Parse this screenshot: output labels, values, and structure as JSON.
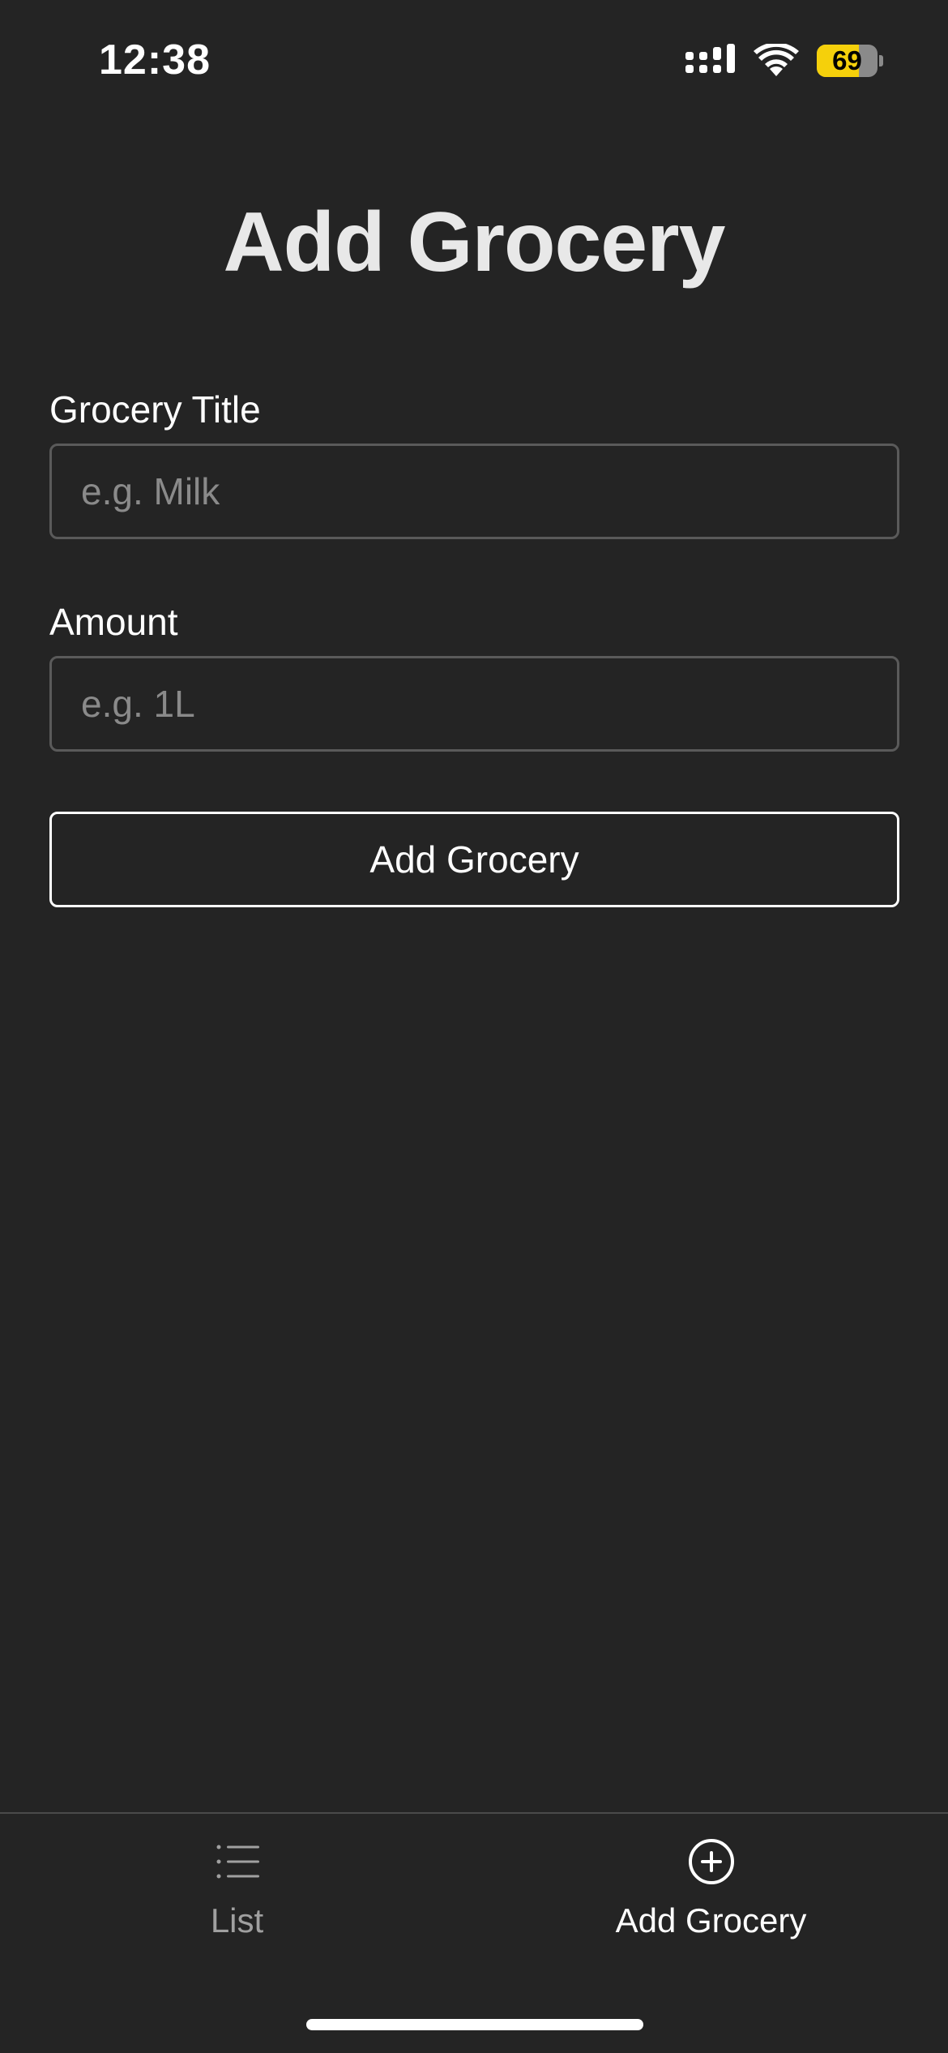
{
  "status_bar": {
    "time": "12:38",
    "battery_level": "69",
    "battery_fraction": 0.69,
    "battery_color": "#f5d00b",
    "icons": [
      "signal-icon",
      "wifi-icon",
      "battery-icon"
    ]
  },
  "page": {
    "title": "Add Grocery"
  },
  "form": {
    "title_label": "Grocery Title",
    "title_placeholder": "e.g. Milk",
    "title_value": "",
    "amount_label": "Amount",
    "amount_placeholder": "e.g. 1L",
    "amount_value": "",
    "submit_label": "Add Grocery"
  },
  "tab_bar": {
    "tabs": [
      {
        "label": "List",
        "icon": "list-icon",
        "active": false
      },
      {
        "label": "Add Grocery",
        "icon": "plus-circle-icon",
        "active": true
      }
    ]
  },
  "colors": {
    "background": "#242424",
    "input_border": "#5a5a5a",
    "placeholder": "#8a8a8a",
    "inactive_tab": "#a0a0a0",
    "active_tab": "#ffffff"
  }
}
